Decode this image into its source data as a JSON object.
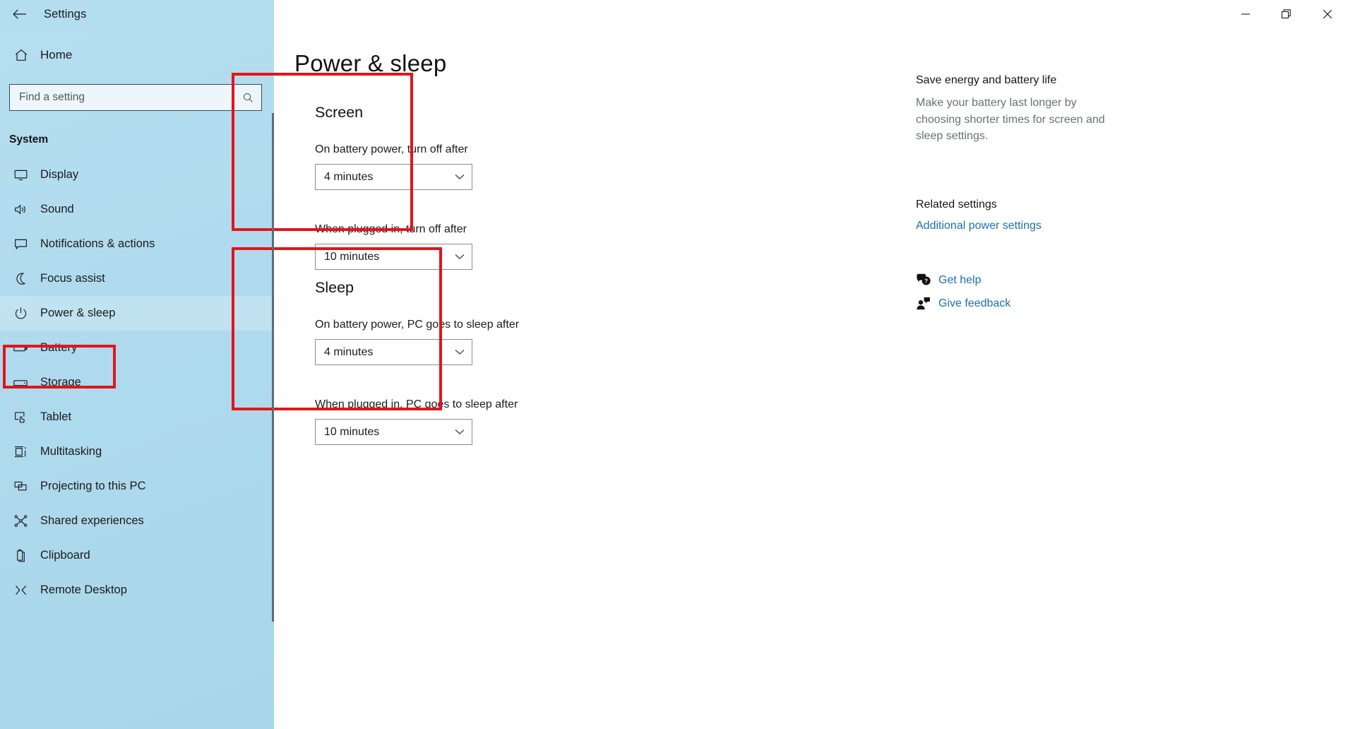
{
  "window": {
    "title": "Settings",
    "back_icon": "back-arrow-icon",
    "controls": [
      {
        "name": "minimize",
        "label": "Minimize"
      },
      {
        "name": "restore",
        "label": "Restore Down"
      },
      {
        "name": "close",
        "label": "Close"
      }
    ]
  },
  "sidebar": {
    "home": {
      "label": "Home",
      "icon": "home-icon"
    },
    "search": {
      "placeholder": "Find a setting",
      "value": "",
      "icon": "search-icon"
    },
    "section_title": "System",
    "items": [
      {
        "label": "Display",
        "icon": "monitor-icon",
        "selected": false
      },
      {
        "label": "Sound",
        "icon": "speaker-icon",
        "selected": false
      },
      {
        "label": "Notifications & actions",
        "icon": "notification-icon",
        "selected": false
      },
      {
        "label": "Focus assist",
        "icon": "moon-icon",
        "selected": false
      },
      {
        "label": "Power & sleep",
        "icon": "power-icon",
        "selected": true
      },
      {
        "label": "Battery",
        "icon": "battery-icon",
        "selected": false
      },
      {
        "label": "Storage",
        "icon": "storage-icon",
        "selected": false
      },
      {
        "label": "Tablet",
        "icon": "tablet-icon",
        "selected": false
      },
      {
        "label": "Multitasking",
        "icon": "multitasking-icon",
        "selected": false
      },
      {
        "label": "Projecting to this PC",
        "icon": "project-icon",
        "selected": false
      },
      {
        "label": "Shared experiences",
        "icon": "share-nodes-icon",
        "selected": false
      },
      {
        "label": "Clipboard",
        "icon": "clipboard-icon",
        "selected": false
      },
      {
        "label": "Remote Desktop",
        "icon": "remote-desktop-icon",
        "selected": false
      }
    ]
  },
  "main": {
    "page_title": "Power & sleep",
    "screen": {
      "heading": "Screen",
      "battery_label": "On battery power, turn off after",
      "battery_value": "4 minutes",
      "plugged_label": "When plugged in, turn off after",
      "plugged_value": "10 minutes"
    },
    "sleep": {
      "heading": "Sleep",
      "battery_label": "On battery power, PC goes to sleep after",
      "battery_value": "4 minutes",
      "plugged_label": "When plugged in, PC goes to sleep after",
      "plugged_value": "10 minutes"
    }
  },
  "right_panel": {
    "info_heading": "Save energy and battery life",
    "info_body": "Make your battery last longer by choosing shorter times for screen and sleep settings.",
    "related_heading": "Related settings",
    "related_link": "Additional power settings",
    "help_links": [
      {
        "label": "Get help",
        "icon": "question-bubble-icon"
      },
      {
        "label": "Give feedback",
        "icon": "feedback-person-icon"
      }
    ]
  },
  "annotations": {
    "highlight_color": "#e3141b",
    "boxes": [
      {
        "target": "sidebar-item-power-and-sleep"
      },
      {
        "target": "screen-group"
      },
      {
        "target": "sleep-group"
      }
    ]
  }
}
